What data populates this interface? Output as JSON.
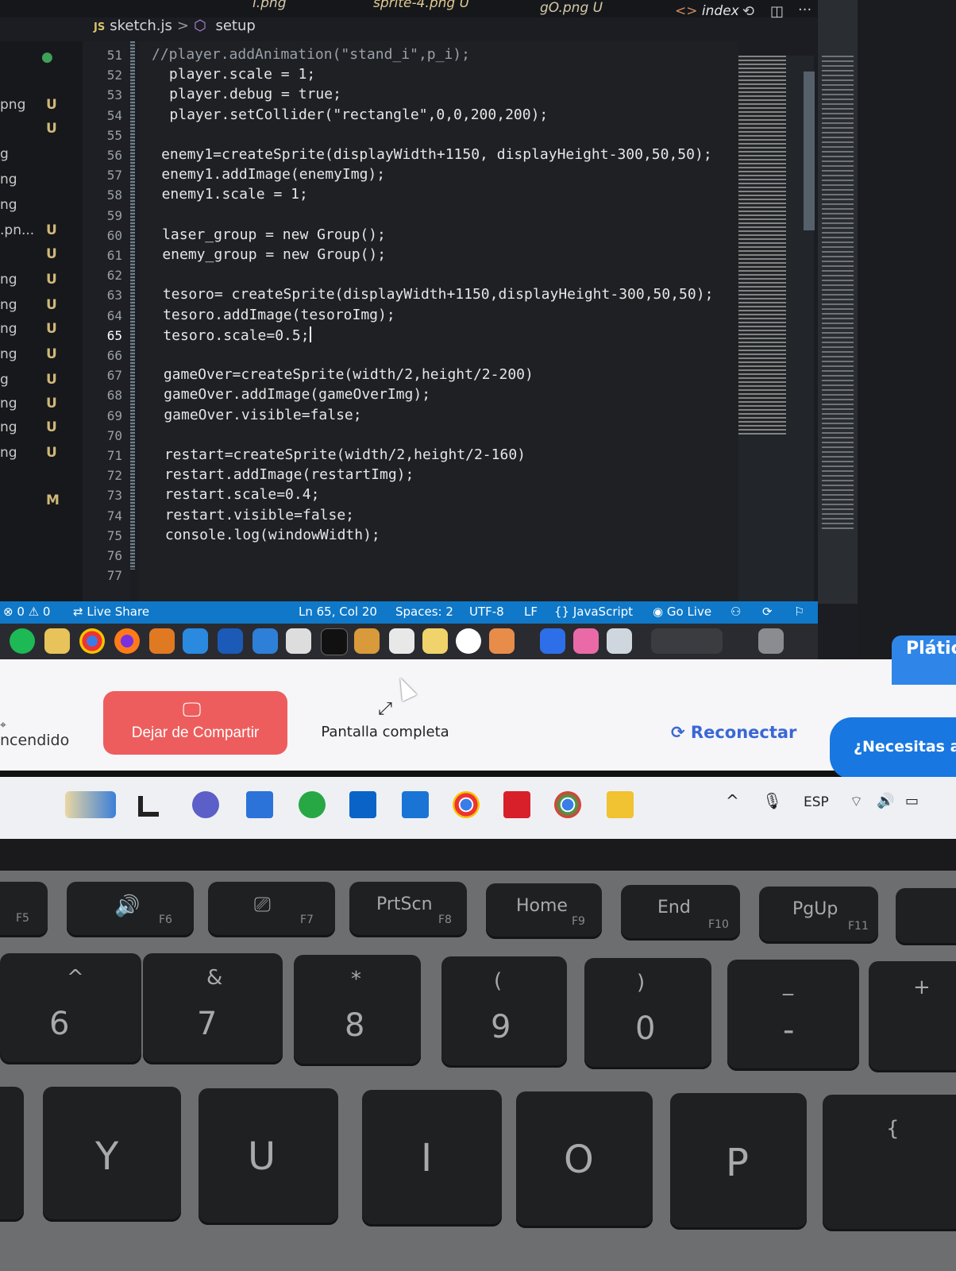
{
  "tabs": {
    "tab1": "i.png",
    "tab2": "sprite-4.png U",
    "tab3": "gO.png U",
    "tab4": "index"
  },
  "breadcrumb": {
    "file": "sketch.js",
    "separator": ">",
    "symbol": "setup"
  },
  "explorer": [
    {
      "name": "",
      "badge": "●"
    },
    {
      "name": "png",
      "badge": "U"
    },
    {
      "name": "",
      "badge": "U"
    },
    {
      "name": "g",
      "badge": ""
    },
    {
      "name": "ng",
      "badge": ""
    },
    {
      "name": "ng",
      "badge": ""
    },
    {
      "name": ".pn...",
      "badge": "U"
    },
    {
      "name": "",
      "badge": "U"
    },
    {
      "name": "ng",
      "badge": "U"
    },
    {
      "name": "ng",
      "badge": "U"
    },
    {
      "name": "ng",
      "badge": "U"
    },
    {
      "name": "ng",
      "badge": "U"
    },
    {
      "name": "g",
      "badge": "U"
    },
    {
      "name": "ng",
      "badge": "U"
    },
    {
      "name": "ng",
      "badge": "U"
    },
    {
      "name": "ng",
      "badge": "U"
    },
    {
      "name": "",
      "badge": "M"
    }
  ],
  "code": [
    {
      "n": "51",
      "text": "//player.addAnimation(\"stand_i\",p_i);"
    },
    {
      "n": "52",
      "text": "  player.scale = 1;"
    },
    {
      "n": "53",
      "text": "  player.debug = true;"
    },
    {
      "n": "54",
      "text": "  player.setCollider(\"rectangle\",0,0,200,200);"
    },
    {
      "n": "55",
      "text": ""
    },
    {
      "n": "56",
      "text": " enemy1=createSprite(displayWidth+1150, displayHeight-300,50,50);"
    },
    {
      "n": "57",
      "text": " enemy1.addImage(enemyImg);"
    },
    {
      "n": "58",
      "text": " enemy1.scale = 1;"
    },
    {
      "n": "59",
      "text": ""
    },
    {
      "n": "60",
      "text": " laser_group = new Group();"
    },
    {
      "n": "61",
      "text": " enemy_group = new Group();"
    },
    {
      "n": "62",
      "text": ""
    },
    {
      "n": "63",
      "text": " tesoro= createSprite(displayWidth+1150,displayHeight-300,50,50);"
    },
    {
      "n": "64",
      "text": " tesoro.addImage(tesoroImg);"
    },
    {
      "n": "65",
      "text": " tesoro.scale=0.5;"
    },
    {
      "n": "66",
      "text": ""
    },
    {
      "n": "67",
      "text": " gameOver=createSprite(width/2,height/2-200)"
    },
    {
      "n": "68",
      "text": " gameOver.addImage(gameOverImg);"
    },
    {
      "n": "69",
      "text": " gameOver.visible=false;"
    },
    {
      "n": "70",
      "text": ""
    },
    {
      "n": "71",
      "text": " restart=createSprite(width/2,height/2-160)"
    },
    {
      "n": "72",
      "text": " restart.addImage(restartImg);"
    },
    {
      "n": "73",
      "text": " restart.scale=0.4;"
    },
    {
      "n": "74",
      "text": " restart.visible=false;"
    },
    {
      "n": "75",
      "text": " console.log(windowWidth);"
    },
    {
      "n": "76",
      "text": ""
    },
    {
      "n": "77",
      "text": ""
    }
  ],
  "status": {
    "problems": "⊗ 0 ⚠ 0",
    "live_share": "Live Share",
    "position": "Ln 65, Col 20",
    "spaces": "Spaces: 2",
    "encoding": "UTF-8",
    "eol": "LF",
    "language": "JavaScript",
    "go_live": "Go Live"
  },
  "share": {
    "encendido": "ncendido",
    "stop_share": "Dejar de Compartir",
    "fullscreen": "Pantalla completa",
    "reconnect": "Reconectar",
    "help": "¿Necesitas a",
    "platic": "Plátic"
  },
  "taskbar": {
    "lang": "ESP"
  },
  "keys": {
    "f5": "F5",
    "f6": "F6",
    "f7": "F7",
    "prtscn": "PrtScn",
    "f8": "F8",
    "home": "Home",
    "f9": "F9",
    "end": "End",
    "f10": "F10",
    "pgup": "PgUp",
    "f11": "F11",
    "k6_top": "^",
    "k6": "6",
    "k7_top": "&",
    "k7": "7",
    "k8_top": "*",
    "k8": "8",
    "k9_top": "(",
    "k9": "9",
    "k0_top": ")",
    "k0": "0",
    "minus_top": "_",
    "minus": "-",
    "plus": "+",
    "y": "Y",
    "u": "U",
    "i": "I",
    "o": "O",
    "p": "P",
    "brace": "{"
  },
  "colors": {
    "statusbar": "#0f78c8",
    "stop_share": "#ee5d5d",
    "reconnect": "#3a67d6",
    "help_bubble": "#1877e0"
  }
}
